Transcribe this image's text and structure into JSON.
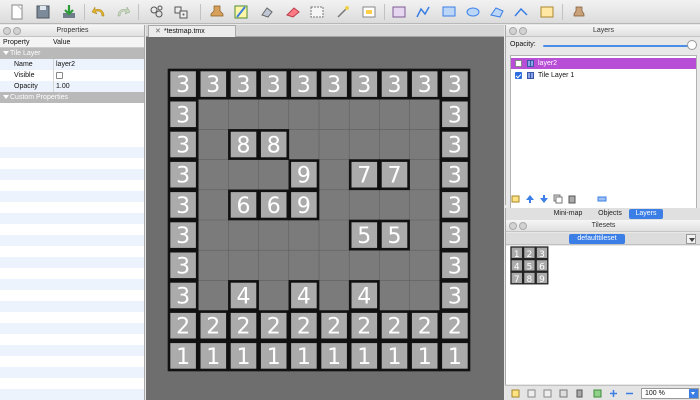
{
  "toolbar": {
    "icons": [
      "new-map-icon",
      "save-icon",
      "export-icon",
      "undo-icon",
      "redo-icon",
      "stamp-brush-icon",
      "random-mode-icon",
      "fill-icon",
      "eraser-icon",
      "rect-select-icon",
      "magic-wand-icon",
      "select-same-tile-icon",
      "insert-tile-icon",
      "edit-polygon-icon",
      "insert-rectangle-icon",
      "insert-ellipse-icon",
      "insert-polygon-icon",
      "insert-polyline-icon",
      "insert-tile-object-icon",
      "stamp-icon"
    ]
  },
  "properties_panel": {
    "title": "Properties",
    "columns": [
      "Property",
      "Value"
    ],
    "group_label": "Tile Layer",
    "rows": [
      {
        "key": "Name",
        "value": "layer2"
      },
      {
        "key": "Visible",
        "value": ""
      },
      {
        "key": "Opacity",
        "value": "1.00"
      }
    ],
    "custom_group": "Custom Properties"
  },
  "map": {
    "tab_title": "*testmap.tmx",
    "grid": [
      [
        "3",
        "3",
        "3",
        "3",
        "3",
        "3",
        "3",
        "3",
        "3",
        "3"
      ],
      [
        "3",
        "",
        "",
        "",
        "",
        "",
        "",
        "",
        "",
        "3"
      ],
      [
        "3",
        "",
        "8",
        "8",
        "",
        "",
        "",
        "",
        "",
        "3"
      ],
      [
        "3",
        "",
        "",
        "",
        "9",
        "",
        "7",
        "7",
        "",
        "3"
      ],
      [
        "3",
        "",
        "6",
        "6",
        "9",
        "",
        "",
        "",
        "",
        "3"
      ],
      [
        "3",
        "",
        "",
        "",
        "",
        "",
        "5",
        "5",
        "",
        "3"
      ],
      [
        "3",
        "",
        "",
        "",
        "",
        "",
        "",
        "",
        "",
        "3"
      ],
      [
        "3",
        "",
        "4",
        "",
        "4",
        "",
        "4",
        "",
        "",
        "3"
      ],
      [
        "2",
        "2",
        "2",
        "2",
        "2",
        "2",
        "2",
        "2",
        "2",
        "2"
      ],
      [
        "1",
        "1",
        "1",
        "1",
        "1",
        "1",
        "1",
        "1",
        "1",
        "1"
      ]
    ]
  },
  "layers_panel": {
    "title": "Layers",
    "opacity_label": "Opacity:",
    "opacity_value": 1.0,
    "layers": [
      {
        "name": "layer2",
        "visible": false,
        "selected": true
      },
      {
        "name": "Tile Layer 1",
        "visible": true,
        "selected": false
      }
    ]
  },
  "dock_tabs": [
    {
      "label": "Mini-map",
      "active": false
    },
    {
      "label": "Objects",
      "active": false
    },
    {
      "label": "Layers",
      "active": true
    }
  ],
  "tilesets_panel": {
    "title": "Tilesets",
    "tab": "defaulttileset",
    "tiles": [
      [
        "1",
        "2",
        "3"
      ],
      [
        "4",
        "5",
        "6"
      ],
      [
        "7",
        "8",
        "9"
      ]
    ],
    "zoom": "100 %"
  },
  "colors": {
    "selection": "#b84ed6",
    "accent": "#3b7fe6",
    "canvas": "#6e6e6e",
    "tile_fill": "#ababab"
  }
}
